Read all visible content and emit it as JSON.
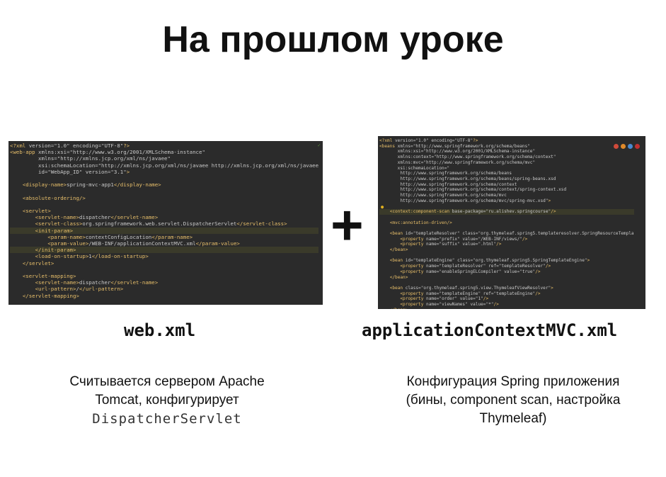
{
  "slide": {
    "title": "На прошлом уроке",
    "plus": "+"
  },
  "left": {
    "filename": "web.xml",
    "desc_line1": "Считывается сервером Apache",
    "desc_line2": "Tomcat, конфигурирует",
    "desc_mono": "DispatcherServlet",
    "code": [
      "<?xml version=\"1.0\" encoding=\"UTF-8\"?>",
      "<web-app xmlns:xsi=\"http://www.w3.org/2001/XMLSchema-instance\"",
      "         xmlns=\"http://xmlns.jcp.org/xml/ns/javaee\"",
      "         xsi:schemaLocation=\"http://xmlns.jcp.org/xml/ns/javaee http://xmlns.jcp.org/xml/ns/javaee",
      "         id=\"WebApp_ID\" version=\"3.1\">",
      "",
      "    <display-name>spring-mvc-app1</display-name>",
      "",
      "    <absolute-ordering/>",
      "",
      "    <servlet>",
      "        <servlet-name>dispatcher</servlet-name>",
      "        <servlet-class>org.springframework.web.servlet.DispatcherServlet</servlet-class>",
      "        <init-param>",
      "            <param-name>contextConfigLocation</param-name>",
      "            <param-value>/WEB-INF/applicationContextMVC.xml</param-value>",
      "        </init-param>",
      "        <load-on-startup>1</load-on-startup>",
      "    </servlet>",
      "",
      "    <servlet-mapping>",
      "        <servlet-name>dispatcher</servlet-name>",
      "        <url-pattern>/</url-pattern>",
      "    </servlet-mapping>",
      "",
      "</web-app>"
    ]
  },
  "right": {
    "filename": "applicationContextMVC.xml",
    "desc_line1": "Конфигурация Spring приложения",
    "desc_line2": "(бины, component scan, настройка",
    "desc_line3": "Thymeleaf)",
    "code": [
      "<?xml version=\"1.0\" encoding=\"UTF-8\"?>",
      "<beans xmlns=\"http://www.springframework.org/schema/beans\"",
      "       xmlns:xsi=\"http://www.w3.org/2001/XMLSchema-instance\"",
      "       xmlns:context=\"http://www.springframework.org/schema/context\"",
      "       xmlns:mvc=\"http://www.springframework.org/schema/mvc\"",
      "       xsi:schemaLocation=\"",
      "        http://www.springframework.org/schema/beans",
      "        http://www.springframework.org/schema/beans/spring-beans.xsd",
      "        http://www.springframework.org/schema/context",
      "        http://www.springframework.org/schema/context/spring-context.xsd",
      "        http://www.springframework.org/schema/mvc",
      "        http://www.springframework.org/schema/mvc/spring-mvc.xsd\">",
      "",
      "    <context:component-scan base-package=\"ru.alishev.springcourse\"/>",
      "",
      "    <mvc:annotation-driven/>",
      "",
      "    <bean id=\"templateResolver\" class=\"org.thymeleaf.spring5.templateresolver.SpringResourceTempla",
      "        <property name=\"prefix\" value=\"/WEB-INF/views/\"/>",
      "        <property name=\"suffix\" value=\".html\"/>",
      "    </bean>",
      "",
      "    <bean id=\"templateEngine\" class=\"org.thymeleaf.spring5.SpringTemplateEngine\">",
      "        <property name=\"templateResolver\" ref=\"templateResolver\"/>",
      "        <property name=\"enableSpringELCompiler\" value=\"true\"/>",
      "    </bean>",
      "",
      "    <bean class=\"org.thymeleaf.spring5.view.ThymeleafViewResolver\">",
      "        <property name=\"templateEngine\" ref=\"templateEngine\"/>",
      "        <property name=\"order\" value=\"1\"/>",
      "        <property name=\"viewNames\" value=\"*\"/>",
      "    </bean>",
      "</beans>"
    ]
  },
  "colors": {
    "editor_bg": "#2b2b2b",
    "tag": "#e8bf6a",
    "attr": "#9fb8d6",
    "value": "#6a8759"
  }
}
